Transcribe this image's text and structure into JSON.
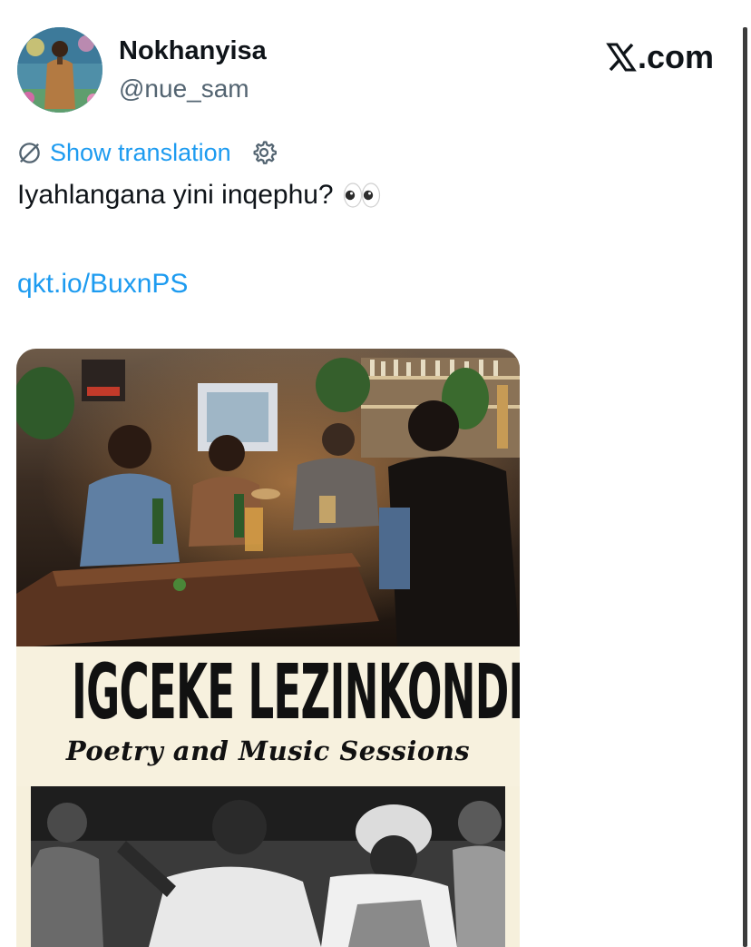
{
  "author": {
    "display_name": "Nokhanyisa",
    "handle": "@nue_sam",
    "avatar": "profile-photo"
  },
  "brand": {
    "label": ".com",
    "icon": "x-logo-icon"
  },
  "translation": {
    "label": "Show translation",
    "icon": "globe-icon",
    "settings_icon": "gear-icon"
  },
  "tweet": {
    "text": "Iyahlangana yini inqephu?",
    "emoji": "eyes-emoji",
    "link": "qkt.io/BuxnPS"
  },
  "media": {
    "poster_title": "IGCEKE LEZINKONDLO",
    "poster_subtitle": "Poetry and Music Sessions",
    "accent_colors": {
      "link": "#1d9bf0",
      "text": "#0f1419",
      "muted": "#536471",
      "poster_bg": "#f7f1de"
    }
  }
}
